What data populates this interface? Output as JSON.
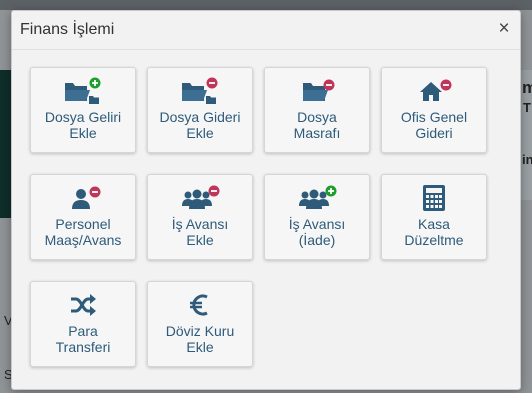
{
  "modal": {
    "title": "Finans İşlemi",
    "close_label": "×"
  },
  "colors": {
    "icon": "#2e5b7a",
    "add": "#1e9e2c",
    "remove": "#c0355a",
    "tile_text": "#2e5b7a"
  },
  "tiles": [
    {
      "line1": "Dosya Geliri",
      "line2": "Ekle",
      "icon": "folder-add-icon"
    },
    {
      "line1": "Dosya Gideri",
      "line2": "Ekle",
      "icon": "folder-remove-icon"
    },
    {
      "line1": "Dosya",
      "line2": "Masrafı",
      "icon": "folder-remove-icon"
    },
    {
      "line1": "Ofis Genel",
      "line2": "Gideri",
      "icon": "home-remove-icon"
    },
    {
      "line1": "Personel",
      "line2": "Maaş/Avans",
      "icon": "user-remove-icon"
    },
    {
      "line1": "İş Avansı",
      "line2": "Ekle",
      "icon": "users-remove-icon"
    },
    {
      "line1": "İş Avansı",
      "line2": "(İade)",
      "icon": "users-add-icon"
    },
    {
      "line1": "Kasa",
      "line2": "Düzeltme",
      "icon": "calculator-icon"
    },
    {
      "line1": "Para",
      "line2": "Transferi",
      "icon": "shuffle-icon"
    },
    {
      "line1": "Döviz Kuru",
      "line2": "Ekle",
      "icon": "euro-icon"
    }
  ],
  "background": {
    "right_top": "m",
    "right_mid": "T",
    "right_low": "in",
    "left_low1": "V",
    "left_low2": "S"
  }
}
